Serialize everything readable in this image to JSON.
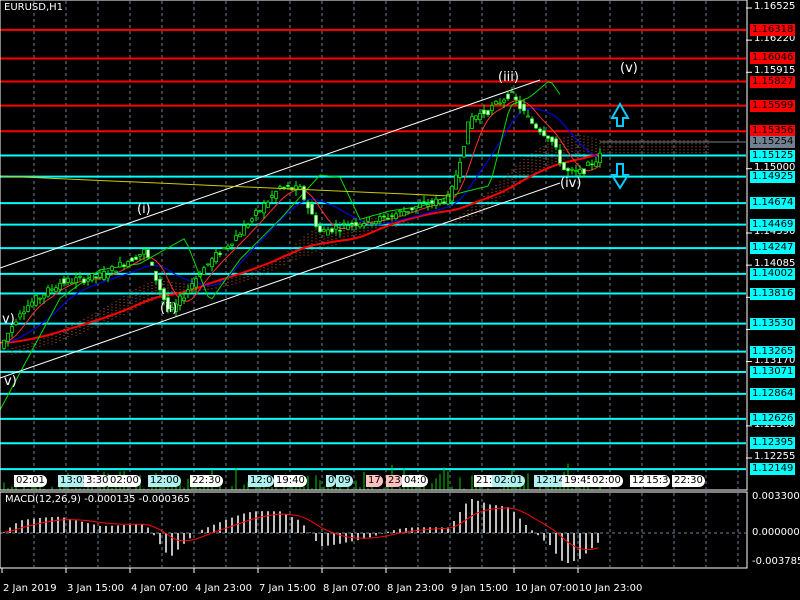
{
  "symbol_title": "EURUSD,H1",
  "macd_title": "MACD(12,26,9) -0.000135 -0.000365",
  "colors": {
    "resistance": "#ff0000",
    "support": "#00ffff",
    "current": "#708090",
    "bg": "#000000"
  },
  "price_axis": [
    "1.16525",
    "1.16220",
    "1.15915",
    "1.15000",
    "1.14390",
    "1.14085",
    "1.13780",
    "1.13475",
    "1.13170",
    "1.12560",
    "1.12255"
  ],
  "current_price": "1.15254",
  "resistance_levels": [
    "1.16318",
    "1.16046",
    "1.15827",
    "1.15599",
    "1.15356"
  ],
  "support_levels": [
    "1.15125",
    "1.14925",
    "1.14674",
    "1.14469",
    "1.14247",
    "1.14002",
    "1.13816",
    "1.13530",
    "1.13265",
    "1.13071",
    "1.12864",
    "1.12626",
    "1.12395",
    "1.12149"
  ],
  "macd_axis": [
    "0.003300",
    "0.000000",
    "-0.003785"
  ],
  "time_axis": [
    "2 Jan 2019",
    "3 Jan 15:00",
    "4 Jan 07:00",
    "4 Jan 23:00",
    "7 Jan 15:00",
    "8 Jan 07:00",
    "8 Jan 23:00",
    "9 Jan 15:00",
    "10 Jan 07:00",
    "10 Jan 23:00"
  ],
  "wave_labels": [
    "v)",
    "v)",
    "(i)",
    "(ii)",
    "(iii)",
    "(iv)",
    "(v)"
  ],
  "events": [
    {
      "t": "02:01",
      "c": "#ffffff"
    },
    {
      "t": "13:05",
      "c": "#b0f0f0"
    },
    {
      "t": "3:30",
      "c": "#ffffff"
    },
    {
      "t": "02:00",
      "c": "#ffffff"
    },
    {
      "t": "12:00",
      "c": "#b0f0f0"
    },
    {
      "t": "22:30",
      "c": "#ffffff"
    },
    {
      "t": "12:0",
      "c": "#b0f0f0"
    },
    {
      "t": "19:40",
      "c": "#ffffff"
    },
    {
      "t": "0",
      "c": "#b0f0f0"
    },
    {
      "t": "09",
      "c": "#b0f0f0"
    },
    {
      "t": "17",
      "c": "#ffc0c0"
    },
    {
      "t": "23",
      "c": "#ffc0c0"
    },
    {
      "t": "04:0",
      "c": "#ffffff"
    },
    {
      "t": "21:0",
      "c": "#ffffff"
    },
    {
      "t": "02:01",
      "c": "#b0f0f0"
    },
    {
      "t": "12:14",
      "c": "#b0f0f0"
    },
    {
      "t": "19:45",
      "c": "#ffffff"
    },
    {
      "t": "02:00",
      "c": "#ffffff"
    },
    {
      "t": "12",
      "c": "#ffffff"
    },
    {
      "t": "15:3",
      "c": "#ffffff"
    },
    {
      "t": "22:30",
      "c": "#ffffff"
    }
  ]
}
